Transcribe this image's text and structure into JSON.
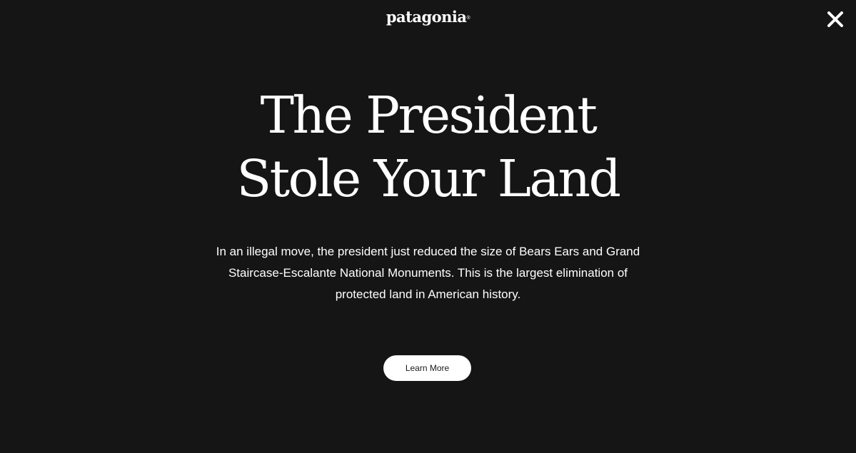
{
  "brand": {
    "name": "patagonia",
    "trademark": "®"
  },
  "close": {
    "icon": "close-icon"
  },
  "hero": {
    "headline_line1": "The President",
    "headline_line2": "Stole Your Land",
    "body": "In an illegal move, the president just reduced the size of Bears Ears and Grand Staircase-Escalante National Monuments. This is the largest elimination of protected land in American history.",
    "cta_label": "Learn More"
  },
  "colors": {
    "background": "#151515",
    "text": "#ffffff",
    "button_bg": "#ffffff",
    "button_text": "#1a1a1a"
  }
}
